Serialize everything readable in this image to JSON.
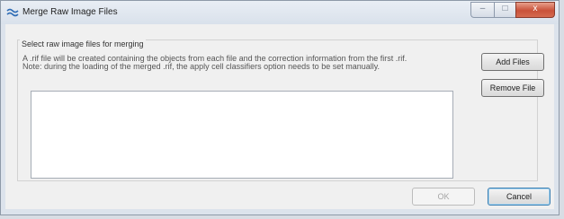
{
  "window": {
    "title": "Merge Raw Image Files",
    "controls": {
      "minimize": "–",
      "maximize": "□",
      "close": "x"
    }
  },
  "group": {
    "label": "Select raw image files for merging",
    "description_line1": "A .rif file will be created containing the objects from each file and the correction information from the first .rif.",
    "description_line2": "Note: during the loading of the merged .rif, the apply cell classifiers option needs to be set manually."
  },
  "buttons": {
    "add_files": "Add Files",
    "remove_file": "Remove File",
    "ok": "OK",
    "cancel": "Cancel"
  },
  "file_list": []
}
